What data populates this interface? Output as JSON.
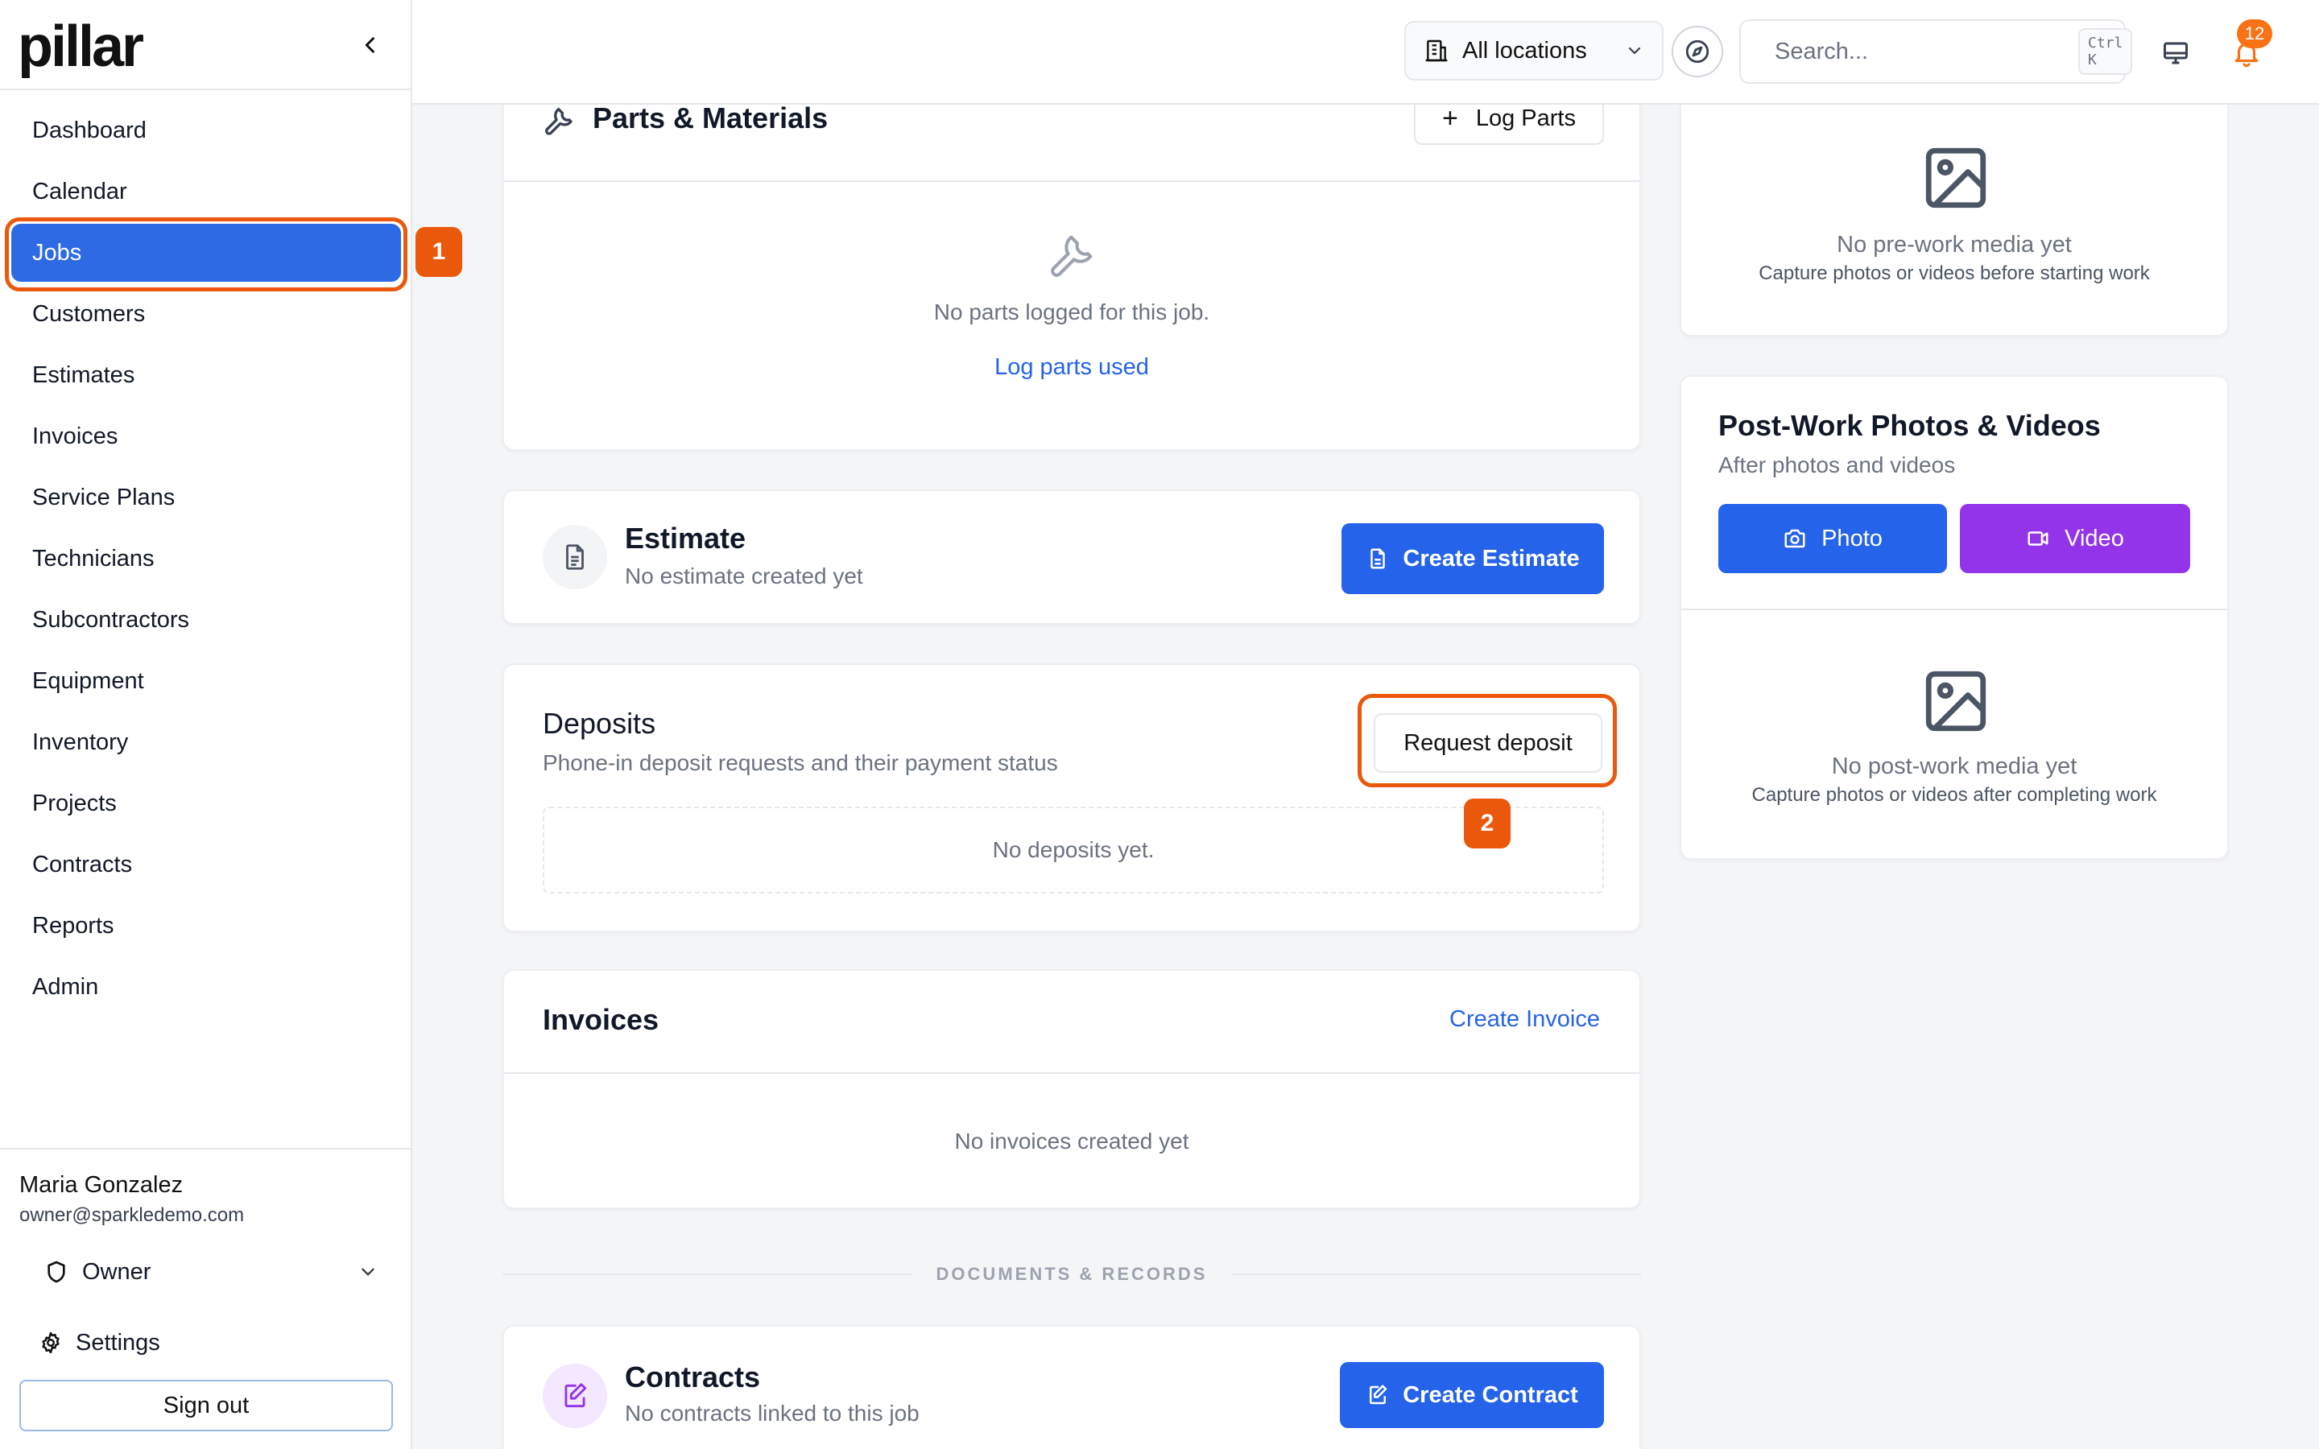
{
  "brand": {
    "logo": "pillar"
  },
  "sidebar": {
    "items": [
      {
        "label": "Dashboard"
      },
      {
        "label": "Calendar"
      },
      {
        "label": "Jobs"
      },
      {
        "label": "Customers"
      },
      {
        "label": "Estimates"
      },
      {
        "label": "Invoices"
      },
      {
        "label": "Service Plans"
      },
      {
        "label": "Technicians"
      },
      {
        "label": "Subcontractors"
      },
      {
        "label": "Equipment"
      },
      {
        "label": "Inventory"
      },
      {
        "label": "Projects"
      },
      {
        "label": "Contracts"
      },
      {
        "label": "Reports"
      },
      {
        "label": "Admin"
      }
    ],
    "active": "Jobs",
    "user": {
      "name": "Maria Gonzalez",
      "email": "owner@sparkledemo.com",
      "role": "Owner"
    },
    "settings_label": "Settings",
    "signout_label": "Sign out"
  },
  "topbar": {
    "location": "All locations",
    "search_placeholder": "Search...",
    "search_shortcut": "Ctrl K",
    "notification_count": "12"
  },
  "annotations": {
    "step1": "1",
    "step2": "2",
    "color": "#ea580c"
  },
  "parts": {
    "title": "Parts & Materials",
    "log_button": "Log Parts",
    "empty_text": "No parts logged for this job.",
    "empty_link": "Log parts used"
  },
  "estimate": {
    "title": "Estimate",
    "subtitle": "No estimate created yet",
    "button": "Create Estimate"
  },
  "deposits": {
    "title": "Deposits",
    "subtitle": "Phone-in deposit requests and their payment status",
    "button": "Request deposit",
    "empty_text": "No deposits yet."
  },
  "invoices": {
    "title": "Invoices",
    "link": "Create Invoice",
    "empty_text": "No invoices created yet"
  },
  "documents_label": "DOCUMENTS & RECORDS",
  "contracts": {
    "title": "Contracts",
    "subtitle": "No contracts linked to this job",
    "button": "Create Contract"
  },
  "pre_work": {
    "empty_title": "No pre-work media yet",
    "empty_sub": "Capture photos or videos before starting work"
  },
  "post_work": {
    "title": "Post-Work Photos & Videos",
    "subtitle": "After photos and videos",
    "photo_button": "Photo",
    "video_button": "Video",
    "empty_title": "No post-work media yet",
    "empty_sub": "Capture photos or videos after completing work"
  },
  "colors": {
    "primary": "#2563eb",
    "active_nav": "#2f6ae5",
    "video": "#9333ea",
    "highlight": "#ea580c",
    "badge": "#f97316"
  }
}
